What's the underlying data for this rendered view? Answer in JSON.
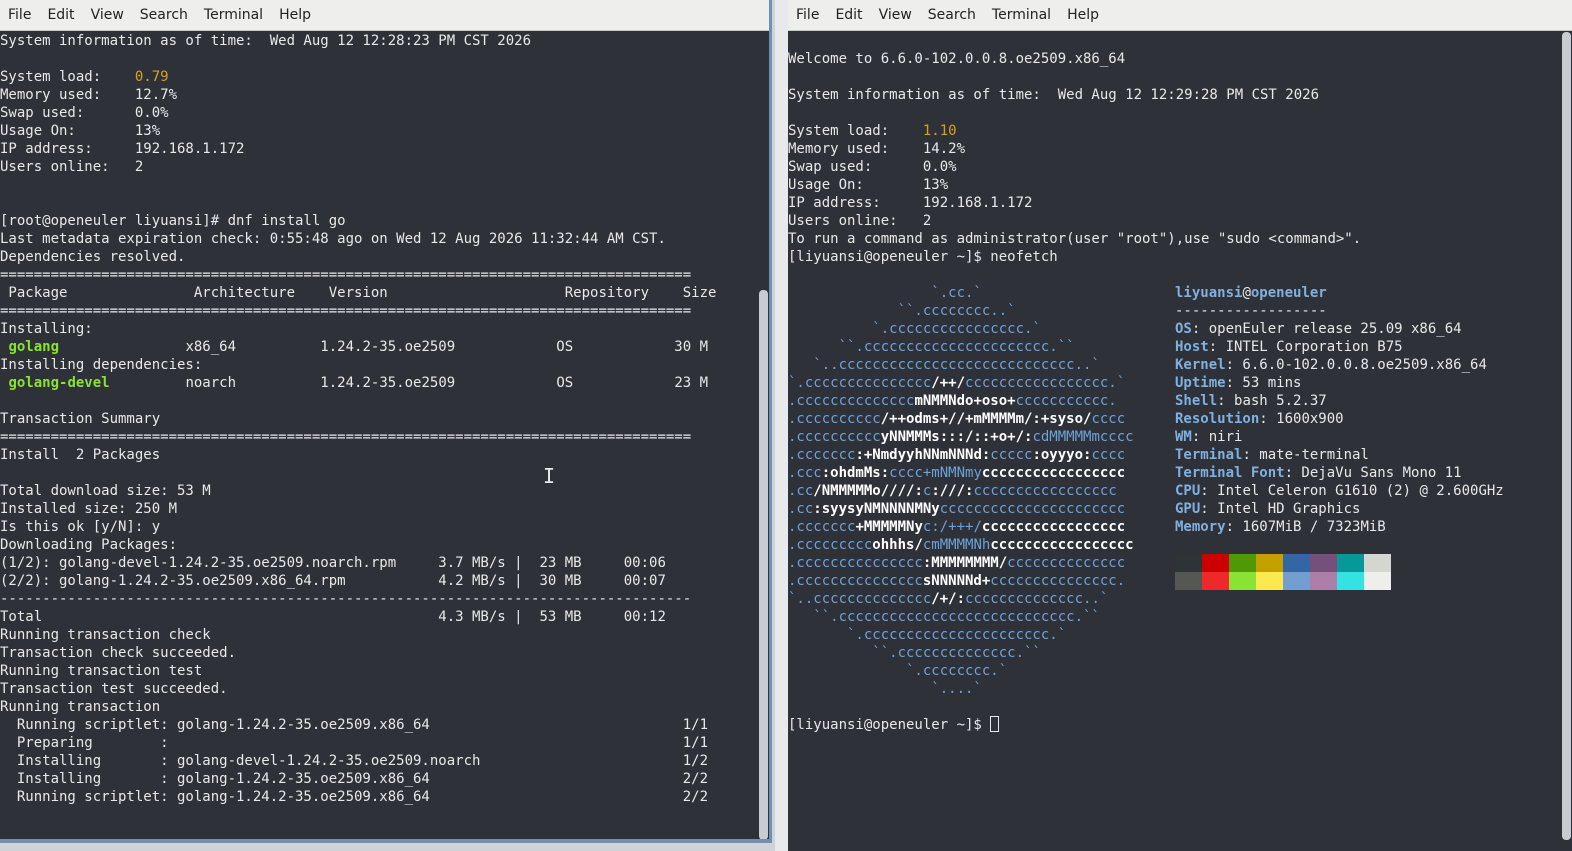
{
  "menu": [
    "File",
    "Edit",
    "View",
    "Search",
    "Terminal",
    "Help"
  ],
  "left_lines": [
    "System information as of time:  Wed Aug 12 12:28:23 PM CST 2026",
    "",
    "System load:    |0.79",
    "Memory used:    12.7%",
    "Swap used:      0.0%",
    "Usage On:       13%",
    "IP address:     192.168.1.172",
    "Users online:   2",
    "",
    "",
    "[root@openeuler liyuansi]# dnf install go",
    "Last metadata expiration check: 0:55:48 ago on Wed 12 Aug 2026 11:32:44 AM CST.",
    "Dependencies resolved.",
    "==================================================================================",
    " Package               Architecture    Version                     Repository    Size",
    "==================================================================================",
    "Installing:",
    " golang               x86_64          1.24.2-35.oe2509            OS            30 M",
    "Installing dependencies:",
    " golang-devel         noarch          1.24.2-35.oe2509            OS            23 M",
    "",
    "Transaction Summary",
    "==================================================================================",
    "Install  2 Packages",
    "",
    "Total download size: 53 M",
    "Installed size: 250 M",
    "Is this ok [y/N]: y",
    "Downloading Packages:",
    "(1/2): golang-devel-1.24.2-35.oe2509.noarch.rpm     3.7 MB/s |  23 MB     00:06",
    "(2/2): golang-1.24.2-35.oe2509.x86_64.rpm           4.2 MB/s |  30 MB     00:07",
    "----------------------------------------------------------------------------------",
    "Total                                               4.3 MB/s |  53 MB     00:12",
    "Running transaction check",
    "Transaction check succeeded.",
    "Running transaction test",
    "Transaction test succeeded.",
    "Running transaction",
    "  Running scriptlet: golang-1.24.2-35.oe2509.x86_64                              1/1",
    "  Preparing        :                                                             1/1",
    "  Installing       : golang-devel-1.24.2-35.oe2509.noarch                        1/2",
    "  Installing       : golang-1.24.2-35.oe2509.x86_64                              2/2",
    "  Running scriptlet: golang-1.24.2-35.oe2509.x86_64                              2/2"
  ],
  "right_top_lines": [
    "",
    "Welcome to 6.6.0-102.0.0.8.oe2509.x86_64",
    "",
    "System information as of time:  Wed Aug 12 12:29:28 PM CST 2026",
    "",
    "System load:    |1.10",
    "Memory used:    14.2%",
    "Swap used:      0.0%",
    "Usage On:       13%",
    "IP address:     192.168.1.172",
    "Users online:   2",
    "To run a command as administrator(user \"root\"),use \"sudo <command>\".",
    "[liyuansi@openeuler ~]$ neofetch"
  ],
  "ascii_logo": [
    "                 `.cc.`",
    "             ``.cccccccc..`",
    "          `.cccccccccccccccc.`",
    "      ``.cccccccccccccccccccccc.``",
    "   `..cccccccccccccccccccccccccccc..`",
    "`.ccccccccccccccc*/++/*ccccccccccccccccc.`",
    ".cccccccccccccc*mNMMNdo+oso+*ccccccccccc.",
    ".cccccccccc*/++odms+//+mMMMMm/:+syso/*cccc",
    ".cccccccccc*yNNMMMs:::/::+o+/:*cdMMMMMmcccc",
    ".ccccccc*:+NmdyyhNNmNNNd:*ccccc*:oyyyo:*cccc",
    ".ccc*:ohdmMs:*cccc+mNMNmy*ccccccccccccccccc",
    ".cc*/NMMMMMo////:*c*:///:*ccccccccccccccccc",
    ".cc*:syysyNMNNNNMNy*cccccccccccccccccccccc",
    ".ccccccc*+MMMMMNy*c:/+++/*ccccccccccccccccc",
    ".ccccccccc*ohhhs/*cmMMMMNh*ccccccccccccccccc",
    ".ccccccccccccccc*:MMMMMMMM/*cccccccccccccc",
    ".ccccccccccccccc*sNNNNNd+*ccccccccccccccc.",
    "`..cccccccccccccc*/+/:*cccccccccccccc..`",
    "   ``.cccccccccccccccccccccccccccc.``",
    "       `.cccccccccccccccccccccc.`",
    "          ``.cccccccccccccc.``",
    "              `.cccccccc.`",
    "                 `....`"
  ],
  "info": {
    "user": "liyuansi",
    "at": "@",
    "host": "openeuler",
    "separator": "------------------",
    "fields": [
      {
        "label": "OS",
        "value": "openEuler release 25.09 x86_64"
      },
      {
        "label": "Host",
        "value": "INTEL Corporation B75"
      },
      {
        "label": "Kernel",
        "value": "6.6.0-102.0.0.8.oe2509.x86_64"
      },
      {
        "label": "Uptime",
        "value": "53 mins"
      },
      {
        "label": "Shell",
        "value": "bash 5.2.37"
      },
      {
        "label": "Resolution",
        "value": "1600x900"
      },
      {
        "label": "WM",
        "value": "niri"
      },
      {
        "label": "Terminal",
        "value": "mate-terminal"
      },
      {
        "label": "Terminal Font",
        "value": "DejaVu Sans Mono 11"
      },
      {
        "label": "CPU",
        "value": "Intel Celeron G1610 (2) @ 2.600GHz"
      },
      {
        "label": "GPU",
        "value": "Intel HD Graphics"
      },
      {
        "label": "Memory",
        "value": "1607MiB / 7323MiB"
      }
    ]
  },
  "palette_top": [
    "#2e3436",
    "#cc0000",
    "#4e9a06",
    "#c4a000",
    "#3465a4",
    "#75507b",
    "#06989a",
    "#d3d7cf"
  ],
  "palette_bottom": [
    "#555753",
    "#ef2929",
    "#8ae234",
    "#fce94f",
    "#729fcf",
    "#ad7fa8",
    "#34e2e2",
    "#eeeeec"
  ],
  "prompt_final": "[liyuansi@openeuler ~]$ "
}
